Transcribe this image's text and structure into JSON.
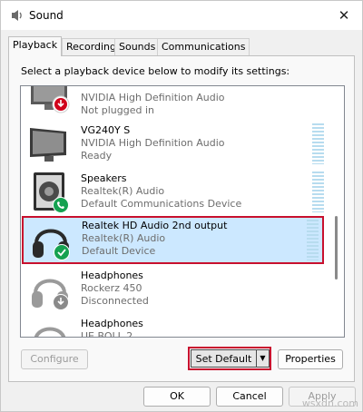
{
  "window": {
    "title": "Sound"
  },
  "tabs": [
    {
      "label": "Playback",
      "active": true
    },
    {
      "label": "Recording",
      "active": false
    },
    {
      "label": "Sounds",
      "active": false
    },
    {
      "label": "Communications",
      "active": false
    }
  ],
  "instruction": "Select a playback device below to modify its settings:",
  "devices": [
    {
      "name": "",
      "line1": "NVIDIA High Definition Audio",
      "line2": "Not plugged in",
      "icon": "monitor-icon",
      "status": "red-down-arrow"
    },
    {
      "name": "VG240Y S",
      "line1": "NVIDIA High Definition Audio",
      "line2": "Ready",
      "icon": "monitor-icon",
      "status": "none"
    },
    {
      "name": "Speakers",
      "line1": "Realtek(R) Audio",
      "line2": "Default Communications Device",
      "icon": "speaker-icon",
      "status": "green-phone"
    },
    {
      "name": "Realtek HD Audio 2nd output",
      "line1": "Realtek(R) Audio",
      "line2": "Default Device",
      "icon": "headphones-icon",
      "status": "green-check",
      "selected": true
    },
    {
      "name": "Headphones",
      "line1": "Rockerz 450",
      "line2": "Disconnected",
      "icon": "headphones-icon",
      "status": "gray-down-arrow"
    },
    {
      "name": "Headphones",
      "line1": "UE BOLL 2",
      "line2": "",
      "icon": "headphones-icon",
      "status": "none"
    }
  ],
  "buttons": {
    "configure": "Configure",
    "set_default": "Set Default",
    "properties": "Properties",
    "ok": "OK",
    "cancel": "Cancel",
    "apply": "Apply"
  },
  "watermark": "wsxdn.com",
  "colors": {
    "selection": "#cce8ff",
    "highlight_border": "#c8102e",
    "meter": "#b7dcef"
  }
}
